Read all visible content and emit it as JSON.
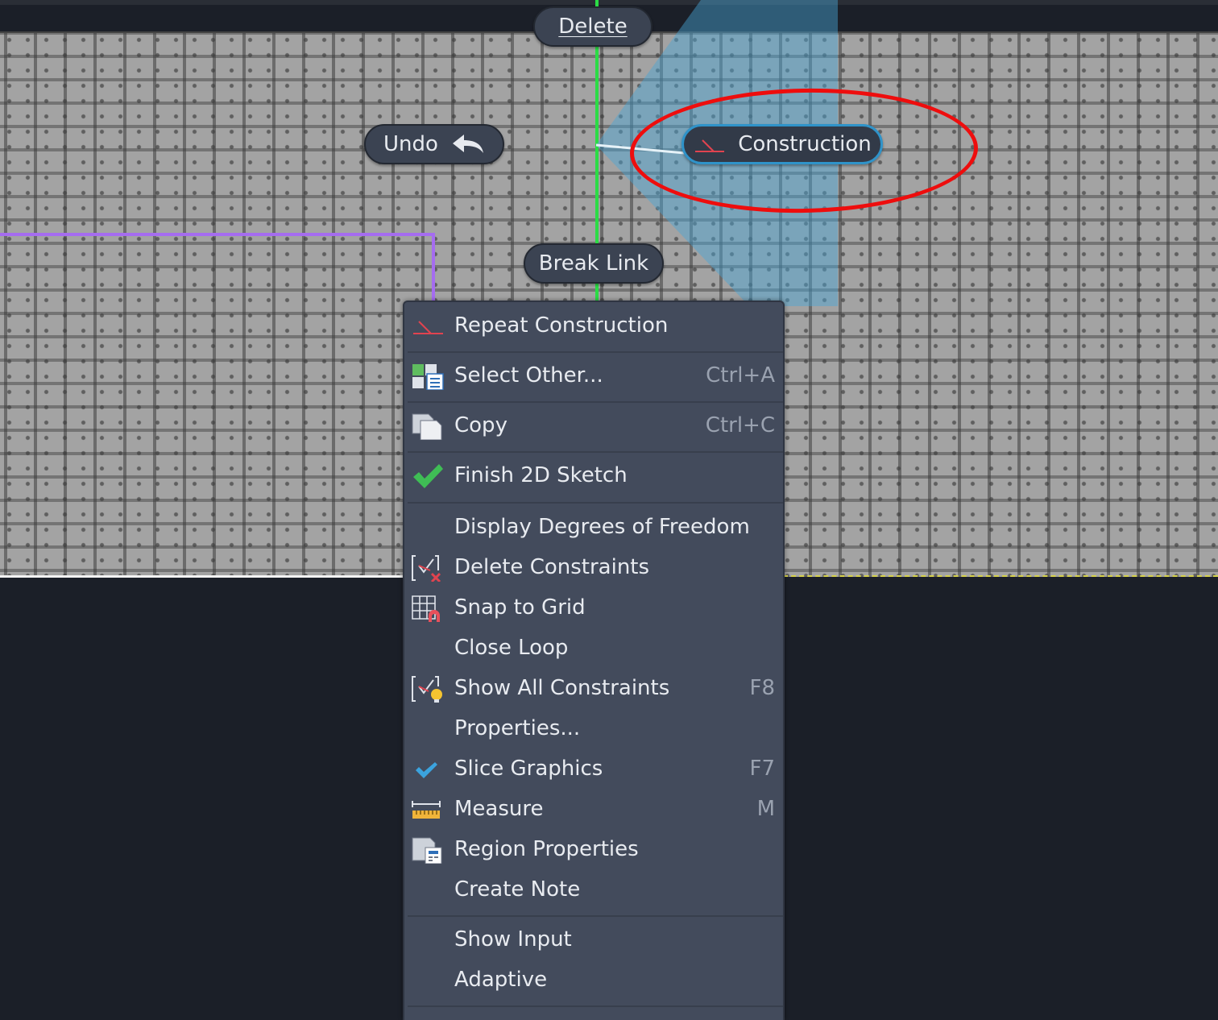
{
  "colors": {
    "canvas": "#a3a3a3",
    "background": "#1b1f28",
    "menu": "#434b5c",
    "accent_blue": "#2f93c9",
    "green_axis": "#2bdc45",
    "purple_line": "#a56cf0",
    "annotation_red": "#ee0d0d"
  },
  "marking_menu": {
    "delete": "Delete",
    "undo": "Undo",
    "construction": "Construction",
    "break_link": "Break Link"
  },
  "context_menu": {
    "items": [
      {
        "label": "Repeat Construction",
        "icon": "construction-icon",
        "shortcut": ""
      },
      {
        "label": "Select Other...",
        "icon": "select-other-icon",
        "shortcut": "Ctrl+A"
      },
      {
        "label": "Copy",
        "icon": "copy-icon",
        "shortcut": "Ctrl+C"
      },
      {
        "label": "Finish 2D Sketch",
        "icon": "checkmark-icon",
        "shortcut": ""
      },
      {
        "label": "Display Degrees of Freedom",
        "icon": "",
        "shortcut": ""
      },
      {
        "label": "Delete Constraints",
        "icon": "delete-constraints-icon",
        "shortcut": ""
      },
      {
        "label": "Snap to Grid",
        "icon": "snap-grid-icon",
        "shortcut": ""
      },
      {
        "label": "Close Loop",
        "icon": "",
        "shortcut": ""
      },
      {
        "label": "Show All Constraints",
        "icon": "show-constraints-icon",
        "shortcut": "F8"
      },
      {
        "label": "Properties...",
        "icon": "",
        "shortcut": ""
      },
      {
        "label": "Slice Graphics",
        "icon": "check-icon",
        "shortcut": "F7"
      },
      {
        "label": "Measure",
        "icon": "ruler-icon",
        "shortcut": "M"
      },
      {
        "label": "Region Properties",
        "icon": "region-properties-icon",
        "shortcut": ""
      },
      {
        "label": "Create Note",
        "icon": "",
        "shortcut": ""
      },
      {
        "label": "Show Input",
        "icon": "",
        "shortcut": ""
      },
      {
        "label": "Adaptive",
        "icon": "",
        "shortcut": ""
      }
    ]
  }
}
